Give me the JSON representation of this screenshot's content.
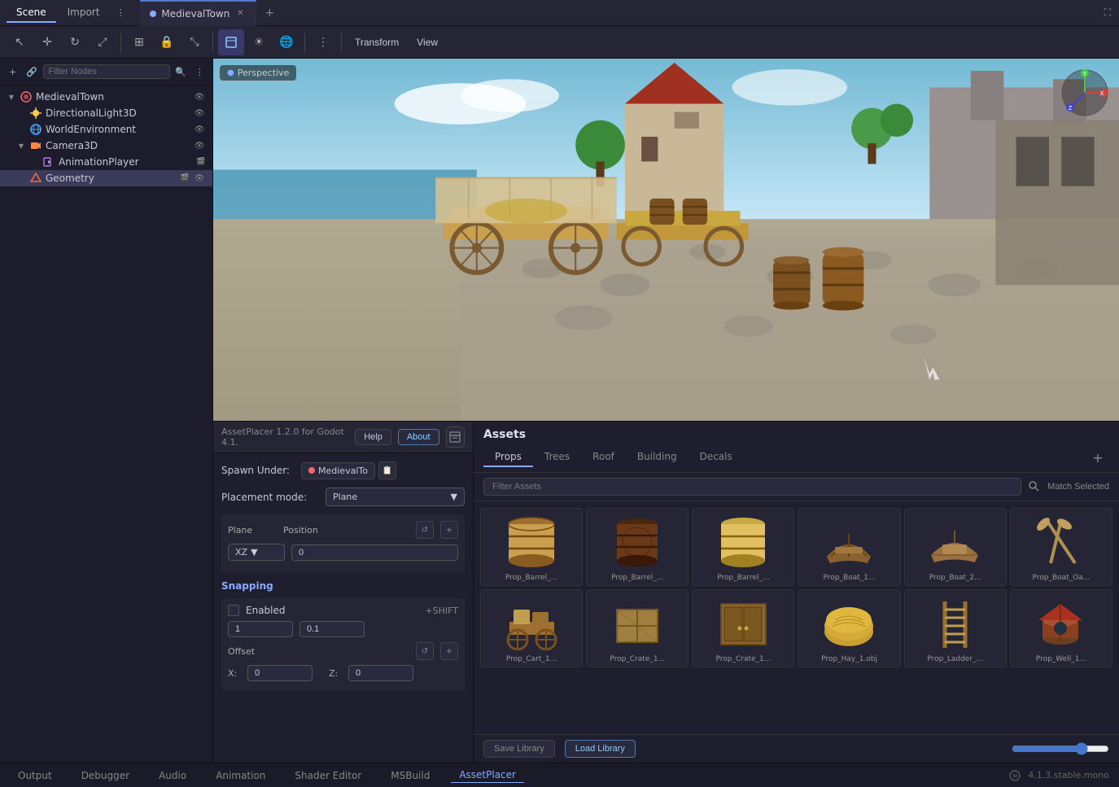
{
  "titleBar": {
    "tabs": [
      {
        "label": "Scene",
        "active": false
      },
      {
        "label": "Import",
        "active": false
      }
    ],
    "activeTab": {
      "label": "MedievalTown",
      "dot_color": "#88aaff"
    },
    "addTab": "+",
    "maximize": "⛶"
  },
  "toolbar": {
    "tools": [
      "↖",
      "↺",
      "⟳",
      "⤢",
      "⊞",
      "🔒",
      "⤡",
      "▣",
      "🔵",
      "⊕",
      "⊙",
      "☄",
      "≡"
    ],
    "menuItems": [
      "Transform",
      "View"
    ],
    "moreIcon": "⋮"
  },
  "scenePanel": {
    "tabs": [
      {
        "label": "Scene",
        "active": true
      },
      {
        "label": "Import",
        "active": false
      }
    ],
    "filterPlaceholder": "Filter Nodes",
    "nodes": [
      {
        "id": "medievaltown",
        "label": "MedievalTown",
        "indent": 0,
        "icon": "node3d",
        "expanded": true,
        "visible": true
      },
      {
        "id": "directionallight",
        "label": "DirectionalLight3D",
        "indent": 1,
        "icon": "light",
        "visible": true
      },
      {
        "id": "worldenv",
        "label": "WorldEnvironment",
        "indent": 1,
        "icon": "world",
        "visible": true
      },
      {
        "id": "camera3d",
        "label": "Camera3D",
        "indent": 1,
        "icon": "camera",
        "expanded": true,
        "visible": true
      },
      {
        "id": "animplayer",
        "label": "AnimationPlayer",
        "indent": 2,
        "icon": "anim",
        "visible": false
      },
      {
        "id": "geometry",
        "label": "Geometry",
        "indent": 1,
        "icon": "geo",
        "visible": true,
        "selected": true
      }
    ]
  },
  "viewport": {
    "label": "Perspective",
    "dotIcon": "●"
  },
  "assetPlacer": {
    "headerTitle": "AssetPlacer 1.2.0 for Godot 4.1.",
    "helpBtn": "Help",
    "aboutBtn": "About",
    "archiveIcon": "🗄",
    "spawnLabel": "Spawn Under:",
    "spawnNode": "MedievalTo",
    "placementLabel": "Placement mode:",
    "placementValue": "Plane",
    "planeSection": {
      "planeLabel": "Plane",
      "positionLabel": "Position",
      "axisLabel": "XZ",
      "positionValue": "0",
      "resetIcon": "↺",
      "addIcon": "+"
    },
    "snappingSection": {
      "title": "Snapping",
      "enabledLabel": "Enabled",
      "shiftLabel": "+SHIFT",
      "value1": "1",
      "value2": "0.1",
      "offsetLabel": "Offset",
      "resetIcon": "↺",
      "addIcon": "+",
      "xLabel": "X:",
      "xValue": "0",
      "zLabel": "Z:",
      "zValue": "0"
    }
  },
  "assets": {
    "title": "Assets",
    "tabs": [
      {
        "label": "Props",
        "active": true
      },
      {
        "label": "Trees",
        "active": false
      },
      {
        "label": "Roof",
        "active": false
      },
      {
        "label": "Building",
        "active": false
      },
      {
        "label": "Decals",
        "active": false
      }
    ],
    "addIcon": "+",
    "filterPlaceholder": "Filter Assets",
    "searchIcon": "🔍",
    "matchSelected": "Match Selected",
    "items": [
      {
        "id": "barrel1",
        "name": "Prop_Barrel_...",
        "shape": "barrel_round",
        "color": "#8B6914"
      },
      {
        "id": "barrel2",
        "name": "Prop_Barrel_...",
        "shape": "barrel_dark",
        "color": "#5A3A0A"
      },
      {
        "id": "barrel3",
        "name": "Prop_Barrel_...",
        "shape": "barrel_light",
        "color": "#AA8830"
      },
      {
        "id": "boat1",
        "name": "Prop_Boat_1...",
        "shape": "boat",
        "color": "#7A5520"
      },
      {
        "id": "boat2",
        "name": "Prop_Boat_2...",
        "shape": "boat2",
        "color": "#8A6530"
      },
      {
        "id": "boatoar",
        "name": "Prop_Boat_Oa...",
        "shape": "oars",
        "color": "#9A8040"
      },
      {
        "id": "cart1",
        "name": "Prop_Cart_1...",
        "shape": "cart",
        "color": "#8B6020"
      },
      {
        "id": "crate1",
        "name": "Prop_Crate_1...",
        "shape": "crate1",
        "color": "#8B7040"
      },
      {
        "id": "crate2",
        "name": "Prop_Crate_1...",
        "shape": "crate2",
        "color": "#7A5A2A"
      },
      {
        "id": "hay1",
        "name": "Prop_Hay_1.obj",
        "shape": "hay",
        "color": "#C8A030"
      },
      {
        "id": "ladder1",
        "name": "Prop_Ladder_...",
        "shape": "ladder",
        "color": "#9A7030"
      },
      {
        "id": "well1",
        "name": "Prop_Well_1...",
        "shape": "well",
        "color": "#8A4020"
      }
    ],
    "footer": {
      "saveLibrary": "Save Library",
      "loadLibrary": "Load Library",
      "zoomValue": 75
    }
  },
  "statusBar": {
    "tabs": [
      "Output",
      "Debugger",
      "Audio",
      "Animation",
      "Shader Editor",
      "MSBuild",
      "AssetPlacer"
    ],
    "activeTab": "AssetPlacer",
    "version": "4.1.3.stable.mono"
  }
}
